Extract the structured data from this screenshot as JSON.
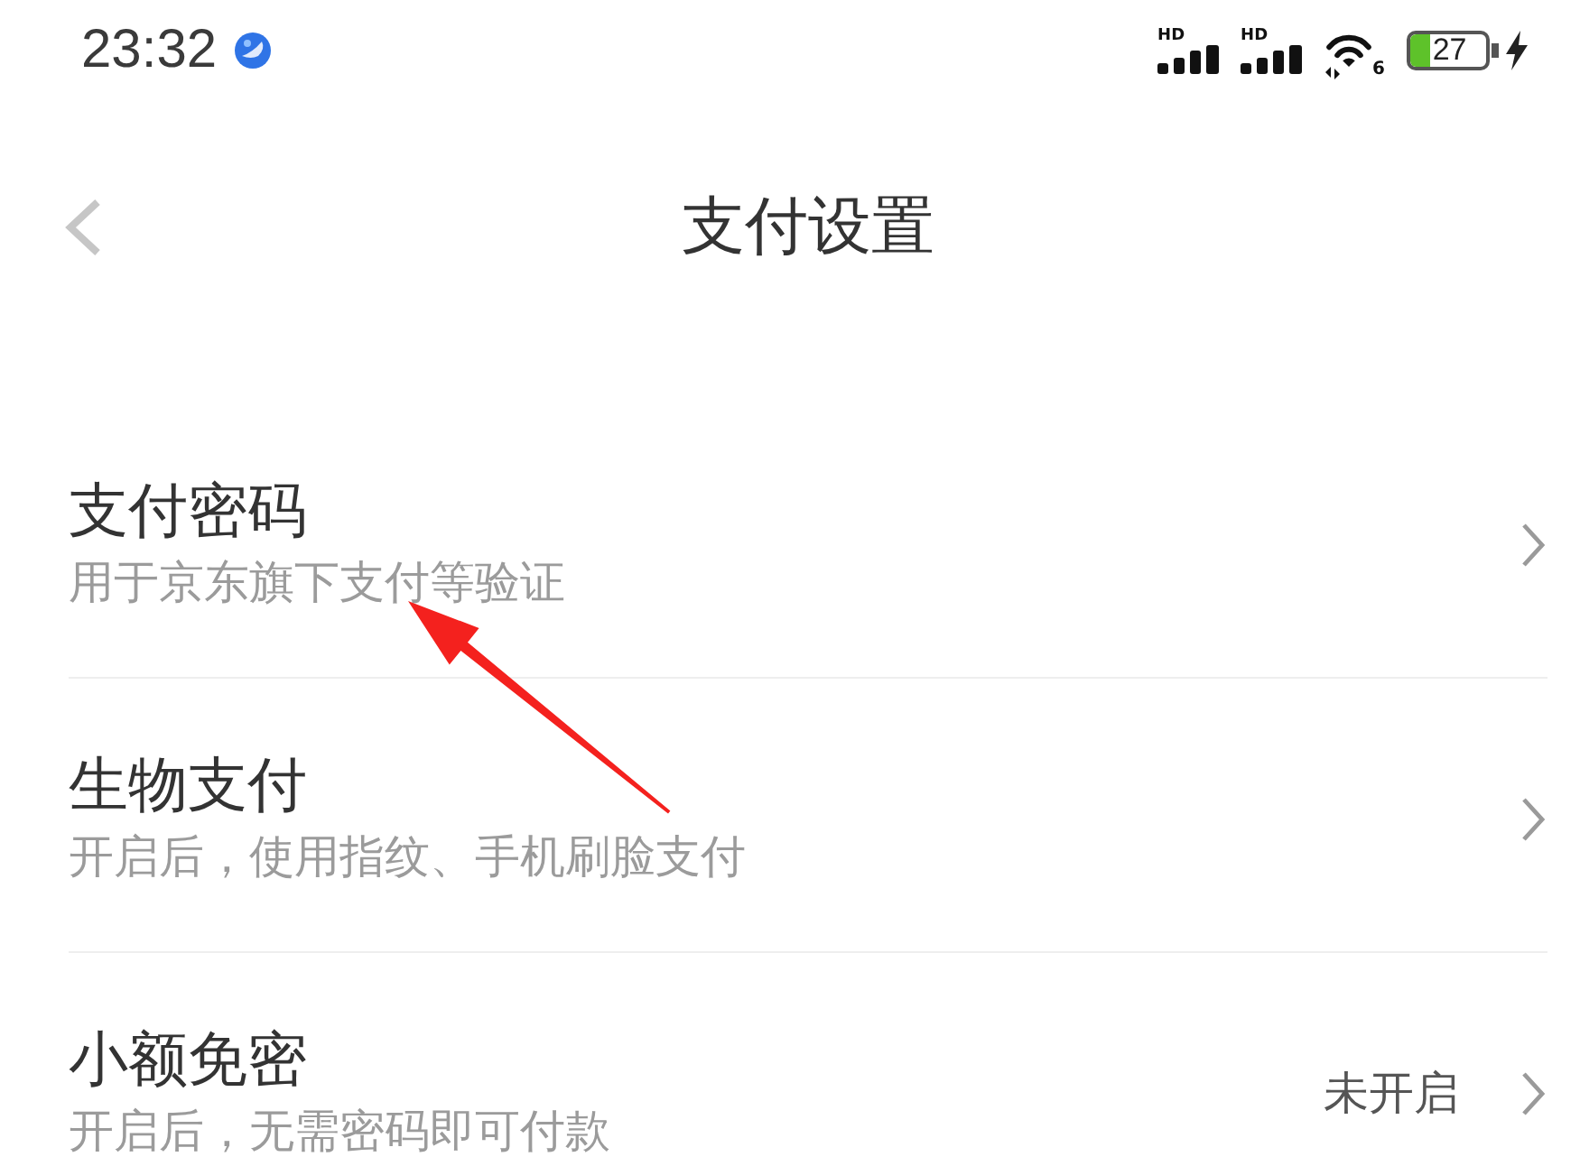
{
  "status_bar": {
    "time": "23:32",
    "signals": [
      {
        "label": "HD"
      },
      {
        "label": "HD"
      }
    ],
    "wifi": {
      "label": "6"
    },
    "battery": {
      "level": 0.27,
      "percent": "27",
      "charging": true
    }
  },
  "nav_bar": {
    "title": "支付设置"
  },
  "settings": [
    {
      "title": "支付密码",
      "subtitle": "用于京东旗下支付等验证"
    },
    {
      "title": "生物支付",
      "subtitle": "开启后，使用指纹、手机刷脸支付"
    },
    {
      "title": "小额免密",
      "subtitle": "开启后，无需密码即可付款",
      "value": "未开启"
    }
  ]
}
